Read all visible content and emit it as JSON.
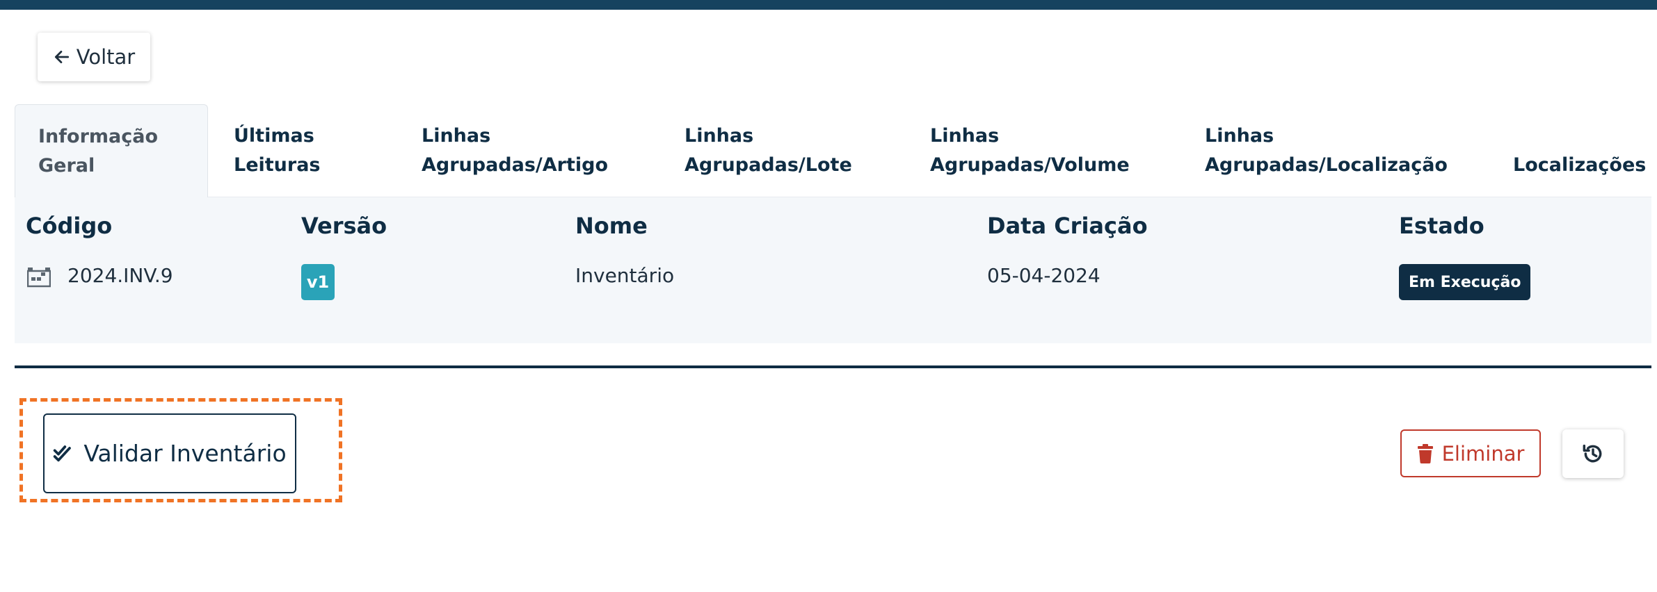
{
  "back_button": {
    "label": "Voltar",
    "icon": "arrow-left-icon"
  },
  "tabs": [
    {
      "line1": "Informação",
      "line2": "Geral",
      "active": true
    },
    {
      "line1": "Últimas",
      "line2": "Leituras"
    },
    {
      "line1": "Linhas",
      "line2": "Agrupadas/Artigo"
    },
    {
      "line1": "Linhas",
      "line2": "Agrupadas/Lote"
    },
    {
      "line1": "Linhas",
      "line2": "Agrupadas/Volume"
    },
    {
      "line1": "Linhas",
      "line2": "Agrupadas/Localização"
    },
    {
      "line1": "",
      "line2": "Localizações"
    }
  ],
  "info": {
    "headers": {
      "codigo": "Código",
      "versao": "Versão",
      "nome": "Nome",
      "data": "Data Criação",
      "estado": "Estado"
    },
    "values": {
      "codigo": "2024.INV.9",
      "versao": "v1",
      "nome": "Inventário",
      "data": "05-04-2024",
      "estado": "Em Execução"
    },
    "colors": {
      "version_badge": "#2aa3b8",
      "status_badge": "#0f2d44"
    }
  },
  "actions": {
    "validate_label": "Validar Inventário",
    "delete_label": "Eliminar",
    "highlight_color": "#f07325",
    "delete_color": "#c0392b"
  }
}
